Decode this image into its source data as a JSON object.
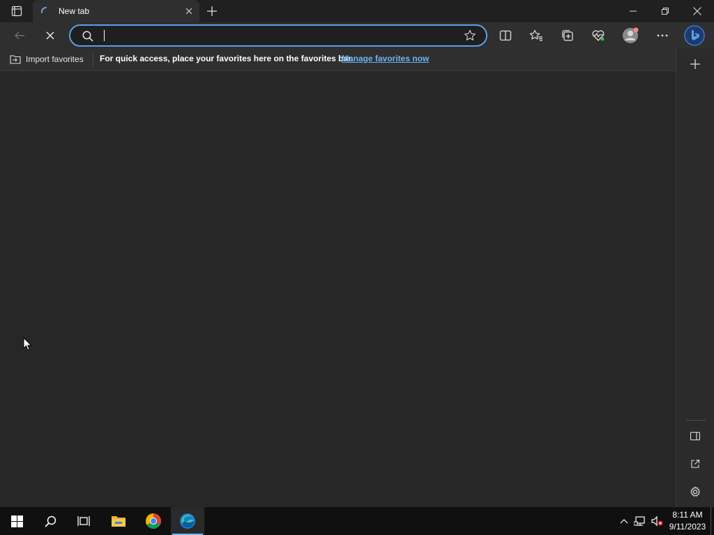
{
  "window": {
    "tab": {
      "title": "New tab",
      "loading": true
    },
    "controls": [
      "minimize",
      "restore",
      "close"
    ]
  },
  "toolbar": {
    "address": {
      "value": "",
      "placeholder": ""
    },
    "buttons": [
      "back-icon",
      "stop-icon",
      "split-screen-icon",
      "favorites-icon",
      "collections-icon",
      "browser-essentials-icon",
      "profile-icon",
      "more-icon",
      "bing-copilot-icon"
    ]
  },
  "favbar": {
    "import_label": "Import favorites",
    "hint": "For quick access, place your favorites here on the favorites bar.",
    "manage_link": "Manage favorites now"
  },
  "sidebar": {
    "buttons": [
      "add-icon",
      "hide-sidebar-icon",
      "external-link-icon",
      "settings-icon"
    ]
  },
  "taskbar": {
    "apps": [
      "windows-start",
      "search",
      "task-view",
      "file-explorer",
      "chrome",
      "edge"
    ],
    "clock": {
      "time": "8:11 AM",
      "date": "9/11/2023"
    }
  },
  "colors": {
    "accent": "#5aa0ea",
    "link": "#6cb4f5",
    "background": "#272727",
    "chrome": "#2f2f2f",
    "taskbar": "#101010"
  }
}
